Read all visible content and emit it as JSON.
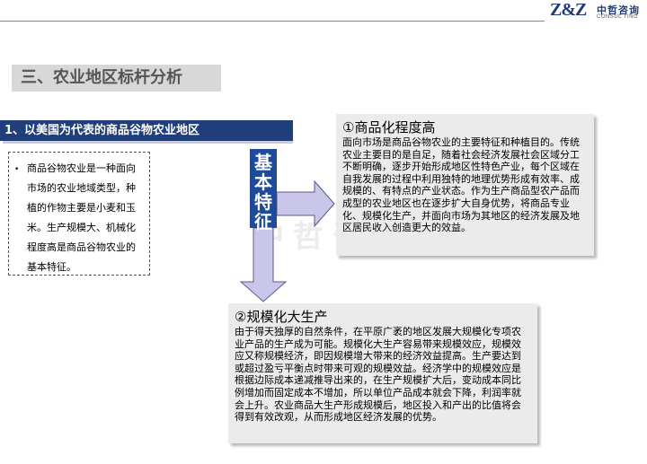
{
  "logo": {
    "mark": "Z&Z",
    "cn": "中哲咨询",
    "en": "CONSUL TING"
  },
  "section_title": "三、农业地区标杆分析",
  "sub_title": "1、以美国为代表的商品谷物农业地区",
  "note": {
    "bullet": "•",
    "text": "商品谷物农业是一种面向市场的农业地域类型，种植的作物主要是小麦和玉米。生产规模大、机械化程度高是商品谷物农业的基本特征。"
  },
  "key_label": [
    "基",
    "本",
    "特",
    "征"
  ],
  "watermark": "中哲咨询",
  "card1": {
    "title": "①商品化程度高",
    "body": "面向市场是商品谷物农业的主要特征和种植目的。传统农业主要目的是自足，随着社会经济发展社会区域分工不断明确，逐步开始形成地区性特色产业，每个区域在自我发展的过程中利用独特的地理优势形成有效率、成规模的、有特点的产业状态。作为生产商品型农产品而成型的农业地区也在逐步扩大自身优势，将商品专业化、规模化生产，并面向市场为其地区的经济发展及地区居民收入创造更大的效益。"
  },
  "card2": {
    "title": "②规模化大生产",
    "body": "由于得天独厚的自然条件，在平原广袤的地区发展大规模化专项农业产品的生产成为可能。规模化大生产容易带来规模效应，规模效应又称规模经济，即因规模增大带来的经济效益提高。生产要达到或超过盈亏平衡点时带来可观的规模效益。经济学中的规模效应是根据边际成本递减推导出来的，在生产规模扩大后，变动成本同比例增加而固定成本不增加，所以单位产品成本就会下降，利润率就会上升。农业商品大生产形成规模后，地区投入和产出的比值将会得到有效改观，从而形成地区经济发展的优势。"
  },
  "colors": {
    "navy": "#203f7a",
    "key_blue": "#1f4a9a",
    "arrow_fill": "#c9c6ea",
    "arrow_stroke": "#5a5a8a"
  }
}
